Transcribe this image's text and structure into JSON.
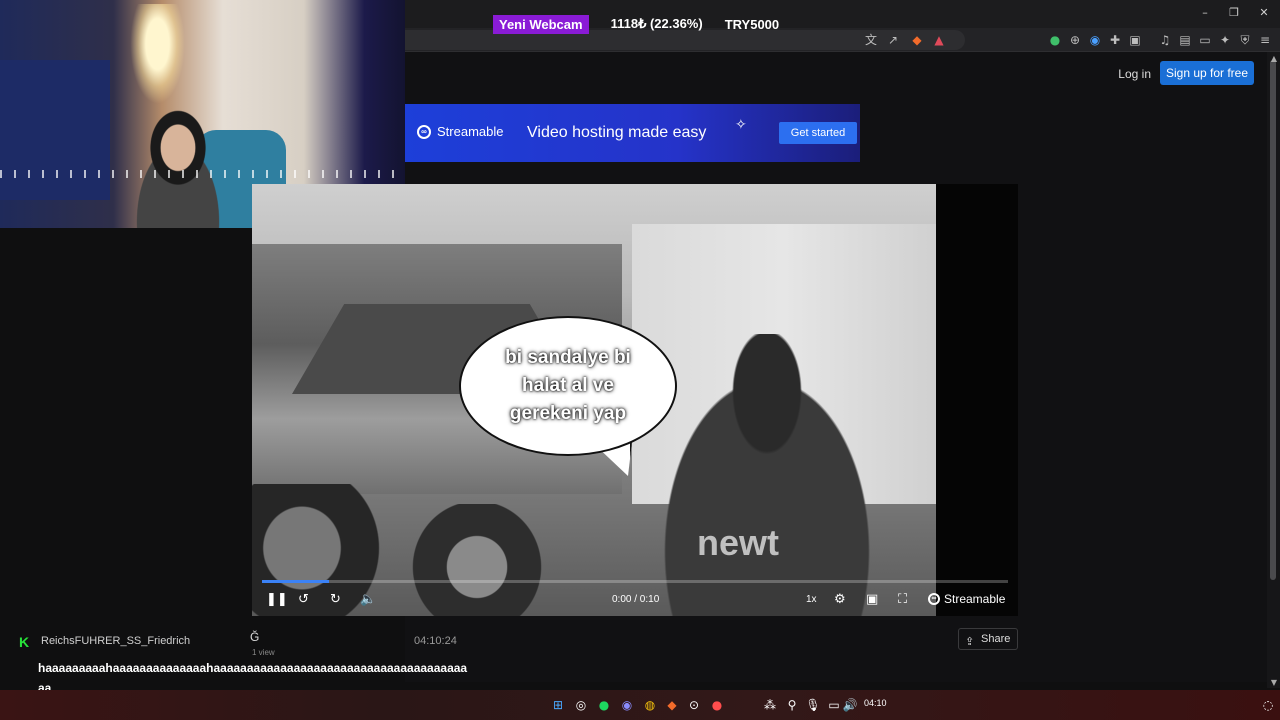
{
  "overlay": {
    "webcam_label": "Yeni Webcam",
    "stat_percent": "1118₺ (22.36%)",
    "stat_goal": "TRY5000"
  },
  "window": {
    "minimize_icon": "minimize-icon",
    "restore_icon": "restore-icon",
    "close_icon": "close-icon"
  },
  "header": {
    "login_label": "Log in",
    "signup_label": "Sign up for free"
  },
  "banner": {
    "brand": "Streamable",
    "tagline": "Video hosting made easy",
    "cta_label": "Get started"
  },
  "video": {
    "bubble_text": "bi sandalye bi halat al ve gerekeni yap",
    "watermark": "newt",
    "time": "0:00 / 0:10",
    "speed": "1x",
    "brand": "Streamable",
    "progress": 0.09
  },
  "meta": {
    "title_char": "Ğ",
    "views": "1 view",
    "share_label": "Share"
  },
  "chat": {
    "username": "ReichsFUHRER_SS_Friedrich",
    "time": "04:10:24",
    "message": "haaaaaaaaahaaaaaaaaaaaaaahaaaaaaaaaaaaaaaaaaaaaaaaaaaaaaaaaaaaaaaa"
  },
  "taskbar": {
    "clock": "04:10"
  },
  "colors": {
    "accent": "#1a6fd6",
    "banner": "#1d3fd9",
    "webcam_badge": "#8a1bd6",
    "chat_k": "#27e33a"
  }
}
